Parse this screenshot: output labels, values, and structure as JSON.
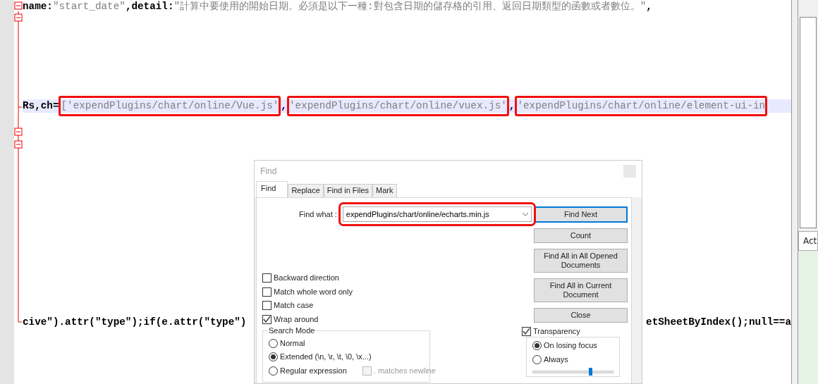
{
  "editor": {
    "lines": [
      {
        "current": false,
        "segments": [
          {
            "text": "name:",
            "kind": "keyword",
            "boxed": false
          },
          {
            "text": "\"start_date\"",
            "kind": "string",
            "boxed": false
          },
          {
            "text": ",detail:",
            "kind": "keyword",
            "boxed": false
          },
          {
            "text": "\"計算中要使用的開始日期。必須是以下一種:對包含日期的儲存格的引用、返回日期類型的函數或者數位。\"",
            "kind": "string",
            "boxed": false
          },
          {
            "text": ",",
            "kind": "keyword",
            "boxed": false
          }
        ]
      },
      {
        "current": true,
        "segments": [
          {
            "text": "Rs,ch=",
            "kind": "keyword",
            "boxed": false
          },
          {
            "text": "['expendPlugins/chart/online/Vue.js'",
            "kind": "string",
            "boxed": true
          },
          {
            "text": ",",
            "kind": "operator",
            "boxed": false
          },
          {
            "text": "'expendPlugins/chart/online/vuex.js'",
            "kind": "string",
            "boxed": true
          },
          {
            "text": ",",
            "kind": "operator",
            "boxed": false
          },
          {
            "text": "'expendPlugins/chart/online/element-ui-in",
            "kind": "string",
            "boxed": true
          }
        ]
      },
      {
        "current": false,
        "segments": [
          {
            "text": "cive\").attr(\"type\");if(e.attr(\"type\")",
            "kind": "keyword",
            "boxed": false
          }
        ],
        "after_dialog": [
          {
            "text": "etSheetByIndex();null==a",
            "kind": "keyword",
            "boxed": false
          }
        ]
      }
    ]
  },
  "side_panel": {
    "tab": "Act"
  },
  "dialog": {
    "title": "Find",
    "tabs": [
      {
        "label": "Find",
        "selected": true
      },
      {
        "label": "Replace",
        "selected": false
      },
      {
        "label": "Find in Files",
        "selected": false
      },
      {
        "label": "Mark",
        "selected": false
      }
    ],
    "find_what": {
      "label": "Find what :",
      "value": "expendPlugins/chart/online/echarts.min.js"
    },
    "buttons": [
      {
        "label": "Find Next",
        "default": true
      },
      {
        "label": "Count",
        "default": false
      },
      {
        "label": "Find All in All Opened Documents",
        "default": false
      },
      {
        "label": "Find All in Current Document",
        "default": false
      },
      {
        "label": "Close",
        "default": false
      }
    ],
    "options": [
      {
        "label": "Backward direction",
        "checked": false
      },
      {
        "label": "Match whole word only",
        "checked": false
      },
      {
        "label": "Match case",
        "checked": false
      },
      {
        "label": "Wrap around",
        "checked": true
      }
    ],
    "search_mode": {
      "title": "Search Mode",
      "modes": [
        {
          "label": "Normal",
          "selected": false
        },
        {
          "label": "Extended (\\n, \\r, \\t, \\0, \\x...)",
          "selected": true
        },
        {
          "label": "Regular expression",
          "selected": false
        }
      ],
      "matches_newline": {
        "label": ". matches newline",
        "checked": false,
        "disabled": true
      }
    },
    "transparency": {
      "label": "Transparency",
      "checked": true,
      "modes": [
        {
          "label": "On losing focus",
          "selected": true
        },
        {
          "label": "Always",
          "selected": false
        }
      ],
      "level": 0.72
    }
  }
}
